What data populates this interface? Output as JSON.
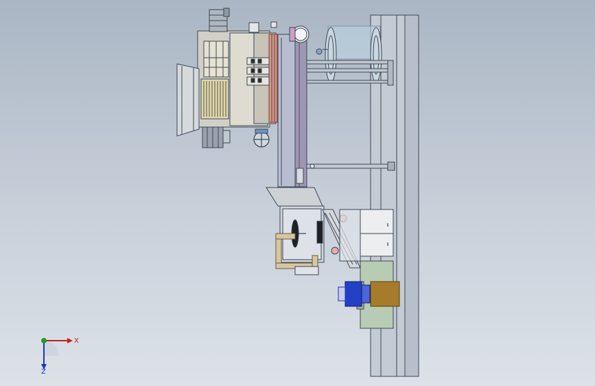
{
  "viewport": {
    "background_top": "#aab6c4",
    "background_bottom": "#dde2e8",
    "line_color": "#3c4652"
  },
  "triad": {
    "x_label": "X",
    "z_label": "Z",
    "x_color": "#c81e1e",
    "y_color": "#1e9a2a",
    "z_color": "#1e2fc8"
  }
}
